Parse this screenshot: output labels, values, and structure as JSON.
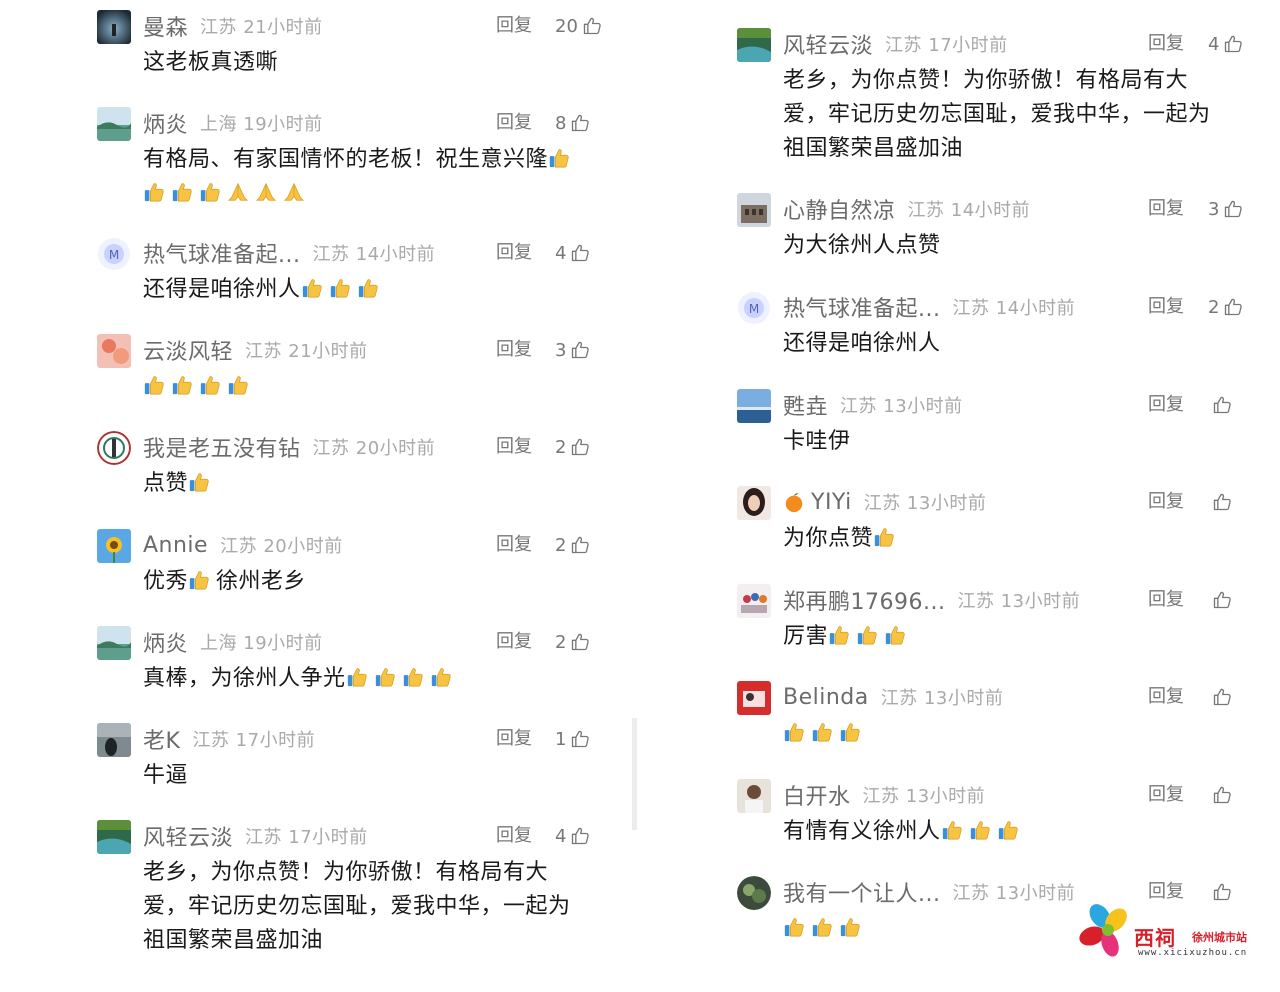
{
  "left": {
    "comments": [
      {
        "user": "曼森",
        "meta": "江苏 21小时前",
        "reply": "回复",
        "likes": "20",
        "text": "这老板真透嘶",
        "emojis": [],
        "avatar": "avatar-dark"
      },
      {
        "user": "炳炎",
        "meta": "上海 19小时前",
        "reply": "回复",
        "likes": "8",
        "text": "有格局、有家国情怀的老板！祝生意兴隆",
        "text2": "",
        "emojis": [
          "thumb"
        ],
        "line2": [
          "thumb",
          "thumb",
          "thumb",
          "pray",
          "pray",
          "pray"
        ],
        "avatar": "avatar-lake"
      },
      {
        "user": "热气球准备起...",
        "meta": "江苏 14小时前",
        "reply": "回复",
        "likes": "4",
        "text": "还得是咱徐州人",
        "emojis": [
          "thumb",
          "thumb",
          "thumb"
        ],
        "avatar": "avatar-m"
      },
      {
        "user": "云淡风轻",
        "meta": "江苏 21小时前",
        "reply": "回复",
        "likes": "3",
        "text": "",
        "emojis": [
          "thumb",
          "thumb",
          "thumb",
          "thumb"
        ],
        "avatar": "avatar-pink"
      },
      {
        "user": "我是老五没有钻",
        "meta": "江苏 20小时前",
        "reply": "回复",
        "likes": "2",
        "text": "点赞",
        "emojis": [
          "thumb"
        ],
        "avatar": "avatar-badge"
      },
      {
        "user": "Annie",
        "meta": "江苏 20小时前",
        "reply": "回复",
        "likes": "2",
        "text": "优秀",
        "emojis": [
          "thumb"
        ],
        "textAfter": "徐州老乡",
        "avatar": "avatar-flower"
      },
      {
        "user": "炳炎",
        "meta": "上海 19小时前",
        "reply": "回复",
        "likes": "2",
        "text": "真棒，为徐州人争光",
        "emojis": [
          "thumb",
          "thumb",
          "thumb",
          "thumb"
        ],
        "avatar": "avatar-lake"
      },
      {
        "user": "老K",
        "meta": "江苏 17小时前",
        "reply": "回复",
        "likes": "1",
        "text": "牛逼",
        "emojis": [],
        "avatar": "avatar-shadow"
      },
      {
        "user": "风轻云淡",
        "meta": "江苏 17小时前",
        "reply": "回复",
        "likes": "4",
        "text": "老乡，为你点赞！为你骄傲！有格局有大",
        "text2": "爱，牢记历史勿忘国耻，爱我中华，一起为",
        "text3": "祖国繁荣昌盛加油",
        "emojis": [],
        "avatar": "avatar-river"
      }
    ]
  },
  "right": {
    "comments": [
      {
        "user": "风轻云淡",
        "meta": "江苏 17小时前",
        "reply": "回复",
        "likes": "4",
        "text": "老乡，为你点赞！为你骄傲！有格局有大",
        "text2": "爱，牢记历史勿忘国耻，爱我中华，一起为",
        "text3": "祖国繁荣昌盛加油",
        "emojis": [],
        "avatar": "avatar-river"
      },
      {
        "user": "心静自然凉",
        "meta": "江苏 14小时前",
        "reply": "回复",
        "likes": "3",
        "text": "为大徐州人点赞",
        "emojis": [],
        "avatar": "avatar-building"
      },
      {
        "user": "热气球准备起...",
        "meta": "江苏 14小时前",
        "reply": "回复",
        "likes": "2",
        "text": "还得是咱徐州人",
        "emojis": [],
        "avatar": "avatar-m"
      },
      {
        "user": "甦垚",
        "meta": "江苏 13小时前",
        "reply": "回复",
        "likes": "",
        "text": "卡哇伊",
        "emojis": [],
        "avatar": "avatar-sky"
      },
      {
        "user": "YIYi",
        "meta": "江苏 13小时前",
        "reply": "回复",
        "likes": "",
        "text": "为你点赞",
        "emojis": [
          "thumb"
        ],
        "avatar": "avatar-girl",
        "prefix": "orange"
      },
      {
        "user": "郑再鹏17696...",
        "meta": "江苏 13小时前",
        "reply": "回复",
        "likes": "",
        "text": "厉害",
        "emojis": [
          "thumb",
          "thumb",
          "thumb"
        ],
        "avatar": "avatar-group"
      },
      {
        "user": "Belinda",
        "meta": "江苏 13小时前",
        "reply": "回复",
        "likes": "",
        "text": "",
        "emojis": [
          "thumb",
          "thumb",
          "thumb"
        ],
        "avatar": "avatar-red"
      },
      {
        "user": "白开水",
        "meta": "江苏 13小时前",
        "reply": "回复",
        "likes": "",
        "text": "有情有义徐州人",
        "emojis": [
          "thumb",
          "thumb",
          "thumb"
        ],
        "avatar": "avatar-man"
      },
      {
        "user": "我有一个让人...",
        "meta": "江苏 13小时前",
        "reply": "回复",
        "likes": "",
        "text": "",
        "emojis": [
          "thumb",
          "thumb",
          "thumb"
        ],
        "avatar": "avatar-plant"
      }
    ]
  },
  "watermark": {
    "brand": "西祠",
    "sub": "徐州城市站",
    "url": "www.xicixuzhou.cn"
  },
  "colors": {
    "username": "#6b6b6b",
    "meta": "#a9a9a9",
    "text": "#1a1a1a",
    "brand": "#d7202a"
  }
}
